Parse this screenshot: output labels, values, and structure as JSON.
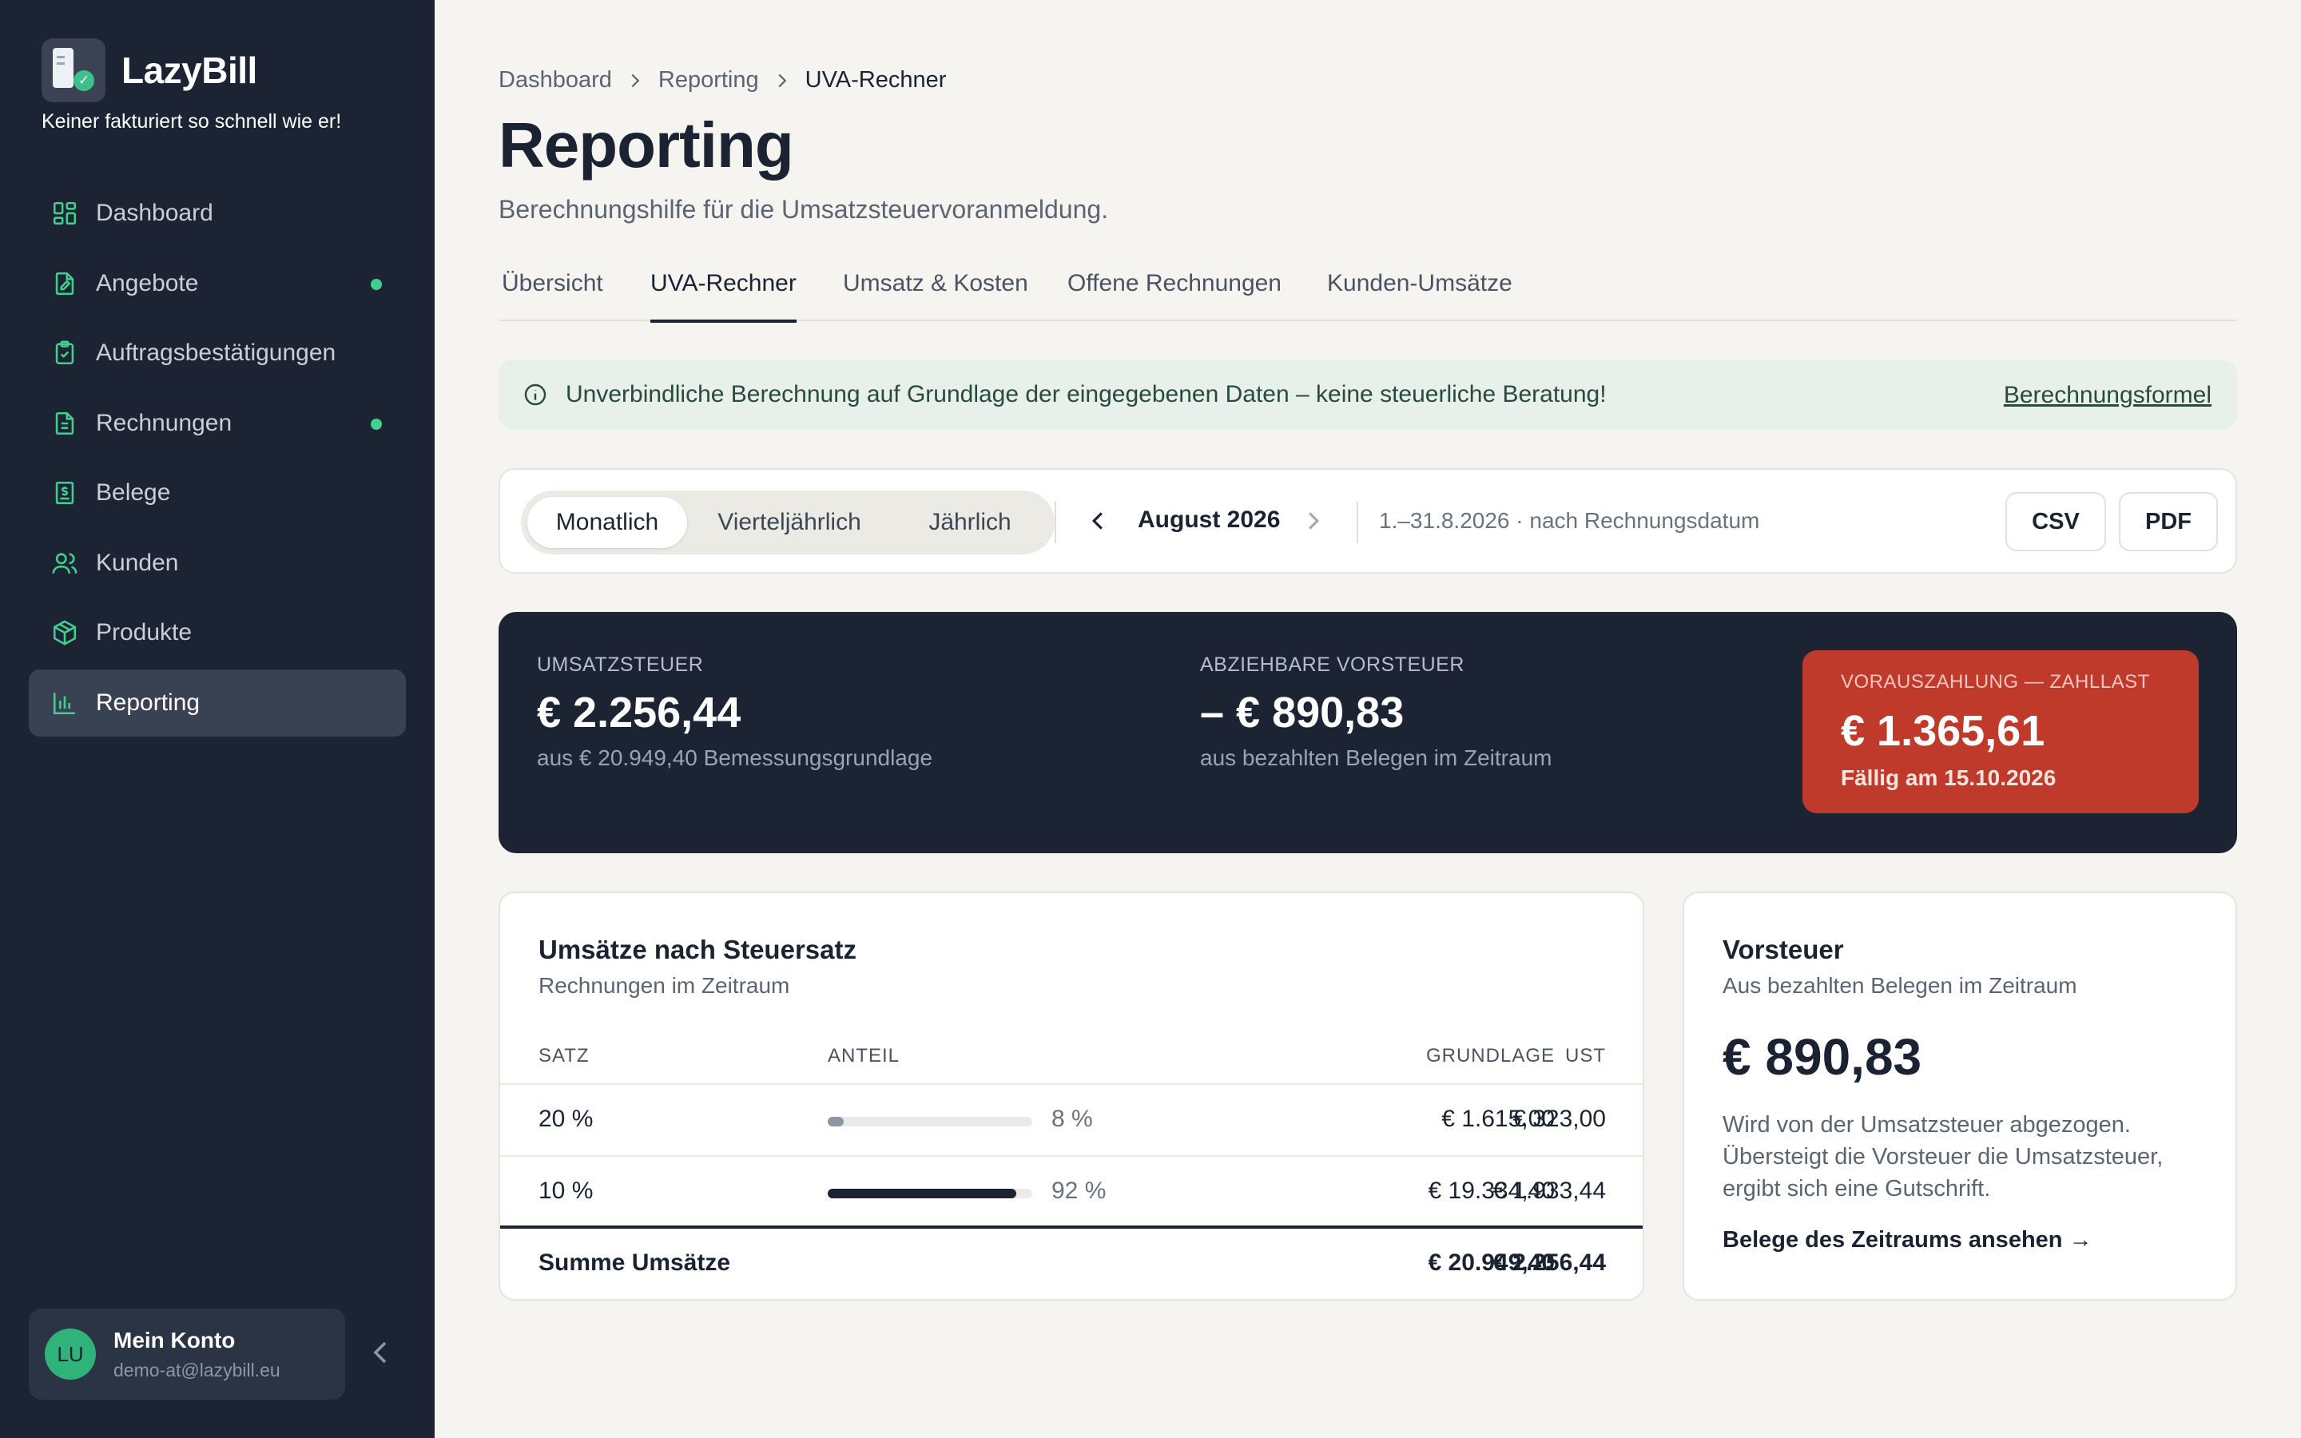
{
  "app": {
    "name": "LazyBill",
    "tagline": "Keiner fakturiert so schnell wie er!"
  },
  "sidebar": {
    "items": [
      {
        "label": "Dashboard",
        "icon": "dashboard-icon",
        "dot": false,
        "active": false
      },
      {
        "label": "Angebote",
        "icon": "offer-document-icon",
        "dot": true,
        "active": false
      },
      {
        "label": "Auftragsbestätigungen",
        "icon": "clipboard-check-icon",
        "dot": false,
        "active": false
      },
      {
        "label": "Rechnungen",
        "icon": "invoice-icon",
        "dot": true,
        "active": false
      },
      {
        "label": "Belege",
        "icon": "receipt-icon",
        "dot": false,
        "active": false
      },
      {
        "label": "Kunden",
        "icon": "users-icon",
        "dot": false,
        "active": false
      },
      {
        "label": "Produkte",
        "icon": "package-icon",
        "dot": false,
        "active": false
      },
      {
        "label": "Reporting",
        "icon": "bar-chart-icon",
        "dot": false,
        "active": true
      }
    ],
    "account": {
      "initials": "LU",
      "name": "Mein Konto",
      "email": "demo-at@lazybill.eu"
    }
  },
  "breadcrumb": {
    "items": [
      "Dashboard",
      "Reporting",
      "UVA-Rechner"
    ]
  },
  "page": {
    "title": "Reporting",
    "subtitle": "Berechnungshilfe für die Umsatzsteuervoranmeldung."
  },
  "tabs": [
    {
      "label": "Übersicht",
      "active": false
    },
    {
      "label": "UVA-Rechner",
      "active": true
    },
    {
      "label": "Umsatz & Kosten",
      "active": false
    },
    {
      "label": "Offene Rechnungen",
      "active": false
    },
    {
      "label": "Kunden-Umsätze",
      "active": false
    }
  ],
  "notice": {
    "text": "Unverbindliche Berechnung auf Grundlage der eingegebenen Daten – keine steuerliche Beratung!",
    "link": "Berechnungsformel"
  },
  "toolbar": {
    "periods": [
      {
        "label": "Monatlich",
        "active": true
      },
      {
        "label": "Vierteljährlich",
        "active": false
      },
      {
        "label": "Jährlich",
        "active": false
      }
    ],
    "current_period": "August 2026",
    "range": "1.–31.8.2026 · nach Rechnungsdatum",
    "csv": "CSV",
    "pdf": "PDF"
  },
  "summary": {
    "ust": {
      "label": "UMSATZSTEUER",
      "value": "€ 2.256,44",
      "note": "aus € 20.949,40 Bemessungsgrundlage"
    },
    "vorsteuer": {
      "label": "ABZIEHBARE VORSTEUER",
      "value": "– € 890,83",
      "note": "aus bezahlten Belegen im Zeitraum"
    },
    "zahllast": {
      "label": "VORAUSZAHLUNG — ZAHLLAST",
      "value": "€ 1.365,61",
      "due": "Fällig am 15.10.2026"
    }
  },
  "sales_table": {
    "title": "Umsätze nach Steuersatz",
    "subtitle": "Rechnungen im Zeitraum",
    "headers": {
      "rate": "SATZ",
      "share": "ANTEIL",
      "base": "GRUNDLAGE",
      "tax": "UST"
    },
    "rows": [
      {
        "rate": "20 %",
        "share": 0.08,
        "share_label": "8 %",
        "base": "€ 1.615,00",
        "tax": "€ 323,00",
        "bar_color": "#8d96a4"
      },
      {
        "rate": "10 %",
        "share": 0.92,
        "share_label": "92 %",
        "base": "€ 19.334,40",
        "tax": "€ 1.933,44",
        "bar_color": "#1b2333"
      }
    ],
    "total": {
      "label": "Summe Umsätze",
      "base": "€ 20.949,40",
      "tax": "€ 2.256,44"
    }
  },
  "vorsteuer_card": {
    "title": "Vorsteuer",
    "subtitle": "Aus bezahlten Belegen im Zeitraum",
    "value": "€ 890,83",
    "text": "Wird von der Umsatzsteuer abgezogen. Übersteigt die Vorsteuer die Umsatzsteuer, ergibt sich eine Gutschrift.",
    "link": "Belege des Zeitraums ansehen →"
  },
  "colors": {
    "sidebar_bg": "#1c2434",
    "accent_green": "#3fd08f",
    "zahllast_red": "#c03a2b",
    "summary_bg": "#1c2434"
  }
}
